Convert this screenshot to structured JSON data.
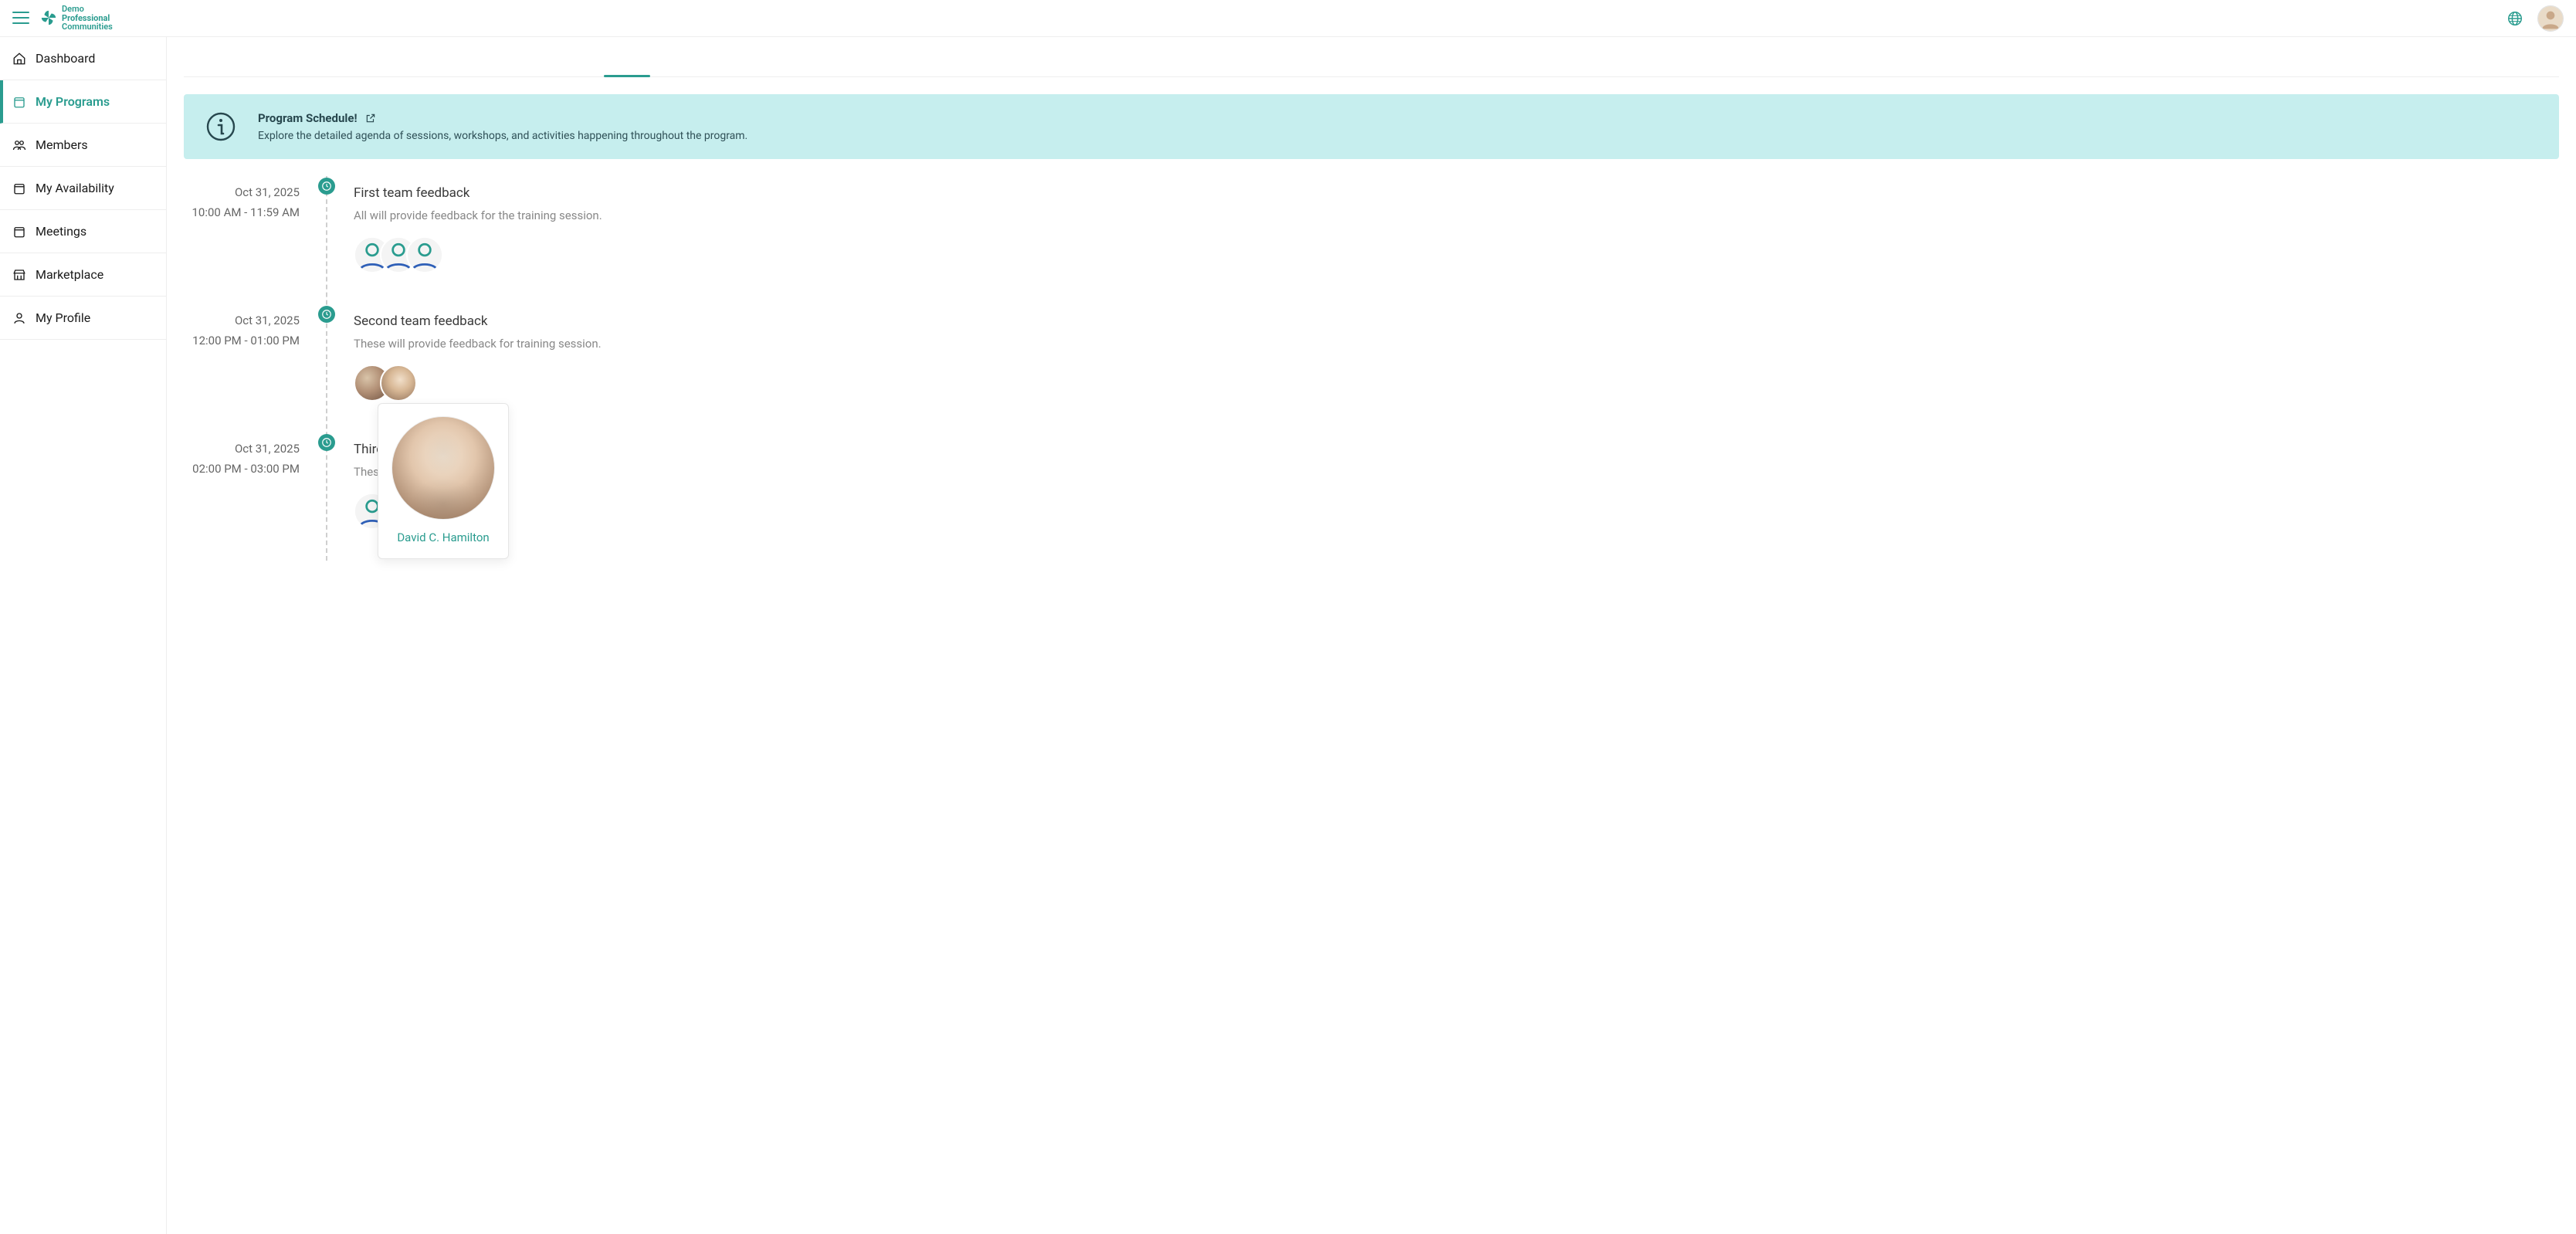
{
  "brand": {
    "line1": "Demo",
    "line2": "Professional",
    "line3": "Communities"
  },
  "sidebar": {
    "items": [
      {
        "label": "Dashboard"
      },
      {
        "label": "My Programs"
      },
      {
        "label": "Members"
      },
      {
        "label": "My Availability"
      },
      {
        "label": "Meetings"
      },
      {
        "label": "Marketplace"
      },
      {
        "label": "My Profile"
      }
    ]
  },
  "banner": {
    "title": "Program Schedule!",
    "desc": "Explore the detailed agenda of sessions, workshops, and activities happening throughout the program."
  },
  "events": [
    {
      "date": "Oct 31, 2025",
      "time": "10:00 AM - 11:59 AM",
      "title": "First team feedback",
      "desc": "All will provide feedback for the training session."
    },
    {
      "date": "Oct 31, 2025",
      "time": "12:00 PM - 01:00 PM",
      "title": "Second team feedback",
      "desc": "These will provide feedback for training session."
    },
    {
      "date": "Oct 31, 2025",
      "time": "02:00 PM - 03:00 PM",
      "title": "Third",
      "desc": "Thes"
    }
  ],
  "popover": {
    "name": "David C. Hamilton"
  }
}
